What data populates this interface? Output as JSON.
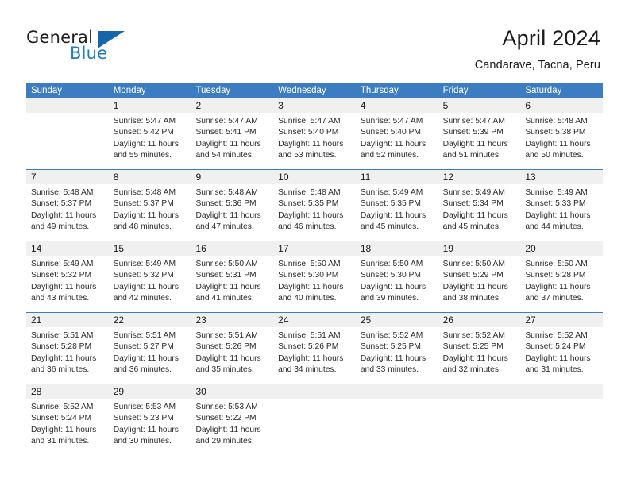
{
  "brand": {
    "name_part1": "General",
    "name_part2": "Blue",
    "triangle_icon": "triangle-logo-icon",
    "accent_color": "#1566ab",
    "blue_text_color": "#1d7cc4"
  },
  "header": {
    "month_title": "April 2024",
    "location": "Candarave, Tacna, Peru"
  },
  "calendar": {
    "header_bg_color": "#3b7dc0",
    "day_number_bg_color": "#f0f0f0",
    "weekdays": [
      "Sunday",
      "Monday",
      "Tuesday",
      "Wednesday",
      "Thursday",
      "Friday",
      "Saturday"
    ],
    "weeks": [
      [
        {
          "day": "",
          "empty": true,
          "sunrise": "",
          "sunset": "",
          "daylight_line1": "",
          "daylight_line2": ""
        },
        {
          "day": "1",
          "empty": false,
          "sunrise": "Sunrise: 5:47 AM",
          "sunset": "Sunset: 5:42 PM",
          "daylight_line1": "Daylight: 11 hours",
          "daylight_line2": "and 55 minutes."
        },
        {
          "day": "2",
          "empty": false,
          "sunrise": "Sunrise: 5:47 AM",
          "sunset": "Sunset: 5:41 PM",
          "daylight_line1": "Daylight: 11 hours",
          "daylight_line2": "and 54 minutes."
        },
        {
          "day": "3",
          "empty": false,
          "sunrise": "Sunrise: 5:47 AM",
          "sunset": "Sunset: 5:40 PM",
          "daylight_line1": "Daylight: 11 hours",
          "daylight_line2": "and 53 minutes."
        },
        {
          "day": "4",
          "empty": false,
          "sunrise": "Sunrise: 5:47 AM",
          "sunset": "Sunset: 5:40 PM",
          "daylight_line1": "Daylight: 11 hours",
          "daylight_line2": "and 52 minutes."
        },
        {
          "day": "5",
          "empty": false,
          "sunrise": "Sunrise: 5:47 AM",
          "sunset": "Sunset: 5:39 PM",
          "daylight_line1": "Daylight: 11 hours",
          "daylight_line2": "and 51 minutes."
        },
        {
          "day": "6",
          "empty": false,
          "sunrise": "Sunrise: 5:48 AM",
          "sunset": "Sunset: 5:38 PM",
          "daylight_line1": "Daylight: 11 hours",
          "daylight_line2": "and 50 minutes."
        }
      ],
      [
        {
          "day": "7",
          "empty": false,
          "sunrise": "Sunrise: 5:48 AM",
          "sunset": "Sunset: 5:37 PM",
          "daylight_line1": "Daylight: 11 hours",
          "daylight_line2": "and 49 minutes."
        },
        {
          "day": "8",
          "empty": false,
          "sunrise": "Sunrise: 5:48 AM",
          "sunset": "Sunset: 5:37 PM",
          "daylight_line1": "Daylight: 11 hours",
          "daylight_line2": "and 48 minutes."
        },
        {
          "day": "9",
          "empty": false,
          "sunrise": "Sunrise: 5:48 AM",
          "sunset": "Sunset: 5:36 PM",
          "daylight_line1": "Daylight: 11 hours",
          "daylight_line2": "and 47 minutes."
        },
        {
          "day": "10",
          "empty": false,
          "sunrise": "Sunrise: 5:48 AM",
          "sunset": "Sunset: 5:35 PM",
          "daylight_line1": "Daylight: 11 hours",
          "daylight_line2": "and 46 minutes."
        },
        {
          "day": "11",
          "empty": false,
          "sunrise": "Sunrise: 5:49 AM",
          "sunset": "Sunset: 5:35 PM",
          "daylight_line1": "Daylight: 11 hours",
          "daylight_line2": "and 45 minutes."
        },
        {
          "day": "12",
          "empty": false,
          "sunrise": "Sunrise: 5:49 AM",
          "sunset": "Sunset: 5:34 PM",
          "daylight_line1": "Daylight: 11 hours",
          "daylight_line2": "and 45 minutes."
        },
        {
          "day": "13",
          "empty": false,
          "sunrise": "Sunrise: 5:49 AM",
          "sunset": "Sunset: 5:33 PM",
          "daylight_line1": "Daylight: 11 hours",
          "daylight_line2": "and 44 minutes."
        }
      ],
      [
        {
          "day": "14",
          "empty": false,
          "sunrise": "Sunrise: 5:49 AM",
          "sunset": "Sunset: 5:32 PM",
          "daylight_line1": "Daylight: 11 hours",
          "daylight_line2": "and 43 minutes."
        },
        {
          "day": "15",
          "empty": false,
          "sunrise": "Sunrise: 5:49 AM",
          "sunset": "Sunset: 5:32 PM",
          "daylight_line1": "Daylight: 11 hours",
          "daylight_line2": "and 42 minutes."
        },
        {
          "day": "16",
          "empty": false,
          "sunrise": "Sunrise: 5:50 AM",
          "sunset": "Sunset: 5:31 PM",
          "daylight_line1": "Daylight: 11 hours",
          "daylight_line2": "and 41 minutes."
        },
        {
          "day": "17",
          "empty": false,
          "sunrise": "Sunrise: 5:50 AM",
          "sunset": "Sunset: 5:30 PM",
          "daylight_line1": "Daylight: 11 hours",
          "daylight_line2": "and 40 minutes."
        },
        {
          "day": "18",
          "empty": false,
          "sunrise": "Sunrise: 5:50 AM",
          "sunset": "Sunset: 5:30 PM",
          "daylight_line1": "Daylight: 11 hours",
          "daylight_line2": "and 39 minutes."
        },
        {
          "day": "19",
          "empty": false,
          "sunrise": "Sunrise: 5:50 AM",
          "sunset": "Sunset: 5:29 PM",
          "daylight_line1": "Daylight: 11 hours",
          "daylight_line2": "and 38 minutes."
        },
        {
          "day": "20",
          "empty": false,
          "sunrise": "Sunrise: 5:50 AM",
          "sunset": "Sunset: 5:28 PM",
          "daylight_line1": "Daylight: 11 hours",
          "daylight_line2": "and 37 minutes."
        }
      ],
      [
        {
          "day": "21",
          "empty": false,
          "sunrise": "Sunrise: 5:51 AM",
          "sunset": "Sunset: 5:28 PM",
          "daylight_line1": "Daylight: 11 hours",
          "daylight_line2": "and 36 minutes."
        },
        {
          "day": "22",
          "empty": false,
          "sunrise": "Sunrise: 5:51 AM",
          "sunset": "Sunset: 5:27 PM",
          "daylight_line1": "Daylight: 11 hours",
          "daylight_line2": "and 36 minutes."
        },
        {
          "day": "23",
          "empty": false,
          "sunrise": "Sunrise: 5:51 AM",
          "sunset": "Sunset: 5:26 PM",
          "daylight_line1": "Daylight: 11 hours",
          "daylight_line2": "and 35 minutes."
        },
        {
          "day": "24",
          "empty": false,
          "sunrise": "Sunrise: 5:51 AM",
          "sunset": "Sunset: 5:26 PM",
          "daylight_line1": "Daylight: 11 hours",
          "daylight_line2": "and 34 minutes."
        },
        {
          "day": "25",
          "empty": false,
          "sunrise": "Sunrise: 5:52 AM",
          "sunset": "Sunset: 5:25 PM",
          "daylight_line1": "Daylight: 11 hours",
          "daylight_line2": "and 33 minutes."
        },
        {
          "day": "26",
          "empty": false,
          "sunrise": "Sunrise: 5:52 AM",
          "sunset": "Sunset: 5:25 PM",
          "daylight_line1": "Daylight: 11 hours",
          "daylight_line2": "and 32 minutes."
        },
        {
          "day": "27",
          "empty": false,
          "sunrise": "Sunrise: 5:52 AM",
          "sunset": "Sunset: 5:24 PM",
          "daylight_line1": "Daylight: 11 hours",
          "daylight_line2": "and 31 minutes."
        }
      ],
      [
        {
          "day": "28",
          "empty": false,
          "sunrise": "Sunrise: 5:52 AM",
          "sunset": "Sunset: 5:24 PM",
          "daylight_line1": "Daylight: 11 hours",
          "daylight_line2": "and 31 minutes."
        },
        {
          "day": "29",
          "empty": false,
          "sunrise": "Sunrise: 5:53 AM",
          "sunset": "Sunset: 5:23 PM",
          "daylight_line1": "Daylight: 11 hours",
          "daylight_line2": "and 30 minutes."
        },
        {
          "day": "30",
          "empty": false,
          "sunrise": "Sunrise: 5:53 AM",
          "sunset": "Sunset: 5:22 PM",
          "daylight_line1": "Daylight: 11 hours",
          "daylight_line2": "and 29 minutes."
        },
        {
          "day": "",
          "empty": true,
          "sunrise": "",
          "sunset": "",
          "daylight_line1": "",
          "daylight_line2": ""
        },
        {
          "day": "",
          "empty": true,
          "sunrise": "",
          "sunset": "",
          "daylight_line1": "",
          "daylight_line2": ""
        },
        {
          "day": "",
          "empty": true,
          "sunrise": "",
          "sunset": "",
          "daylight_line1": "",
          "daylight_line2": ""
        },
        {
          "day": "",
          "empty": true,
          "sunrise": "",
          "sunset": "",
          "daylight_line1": "",
          "daylight_line2": ""
        }
      ]
    ]
  }
}
